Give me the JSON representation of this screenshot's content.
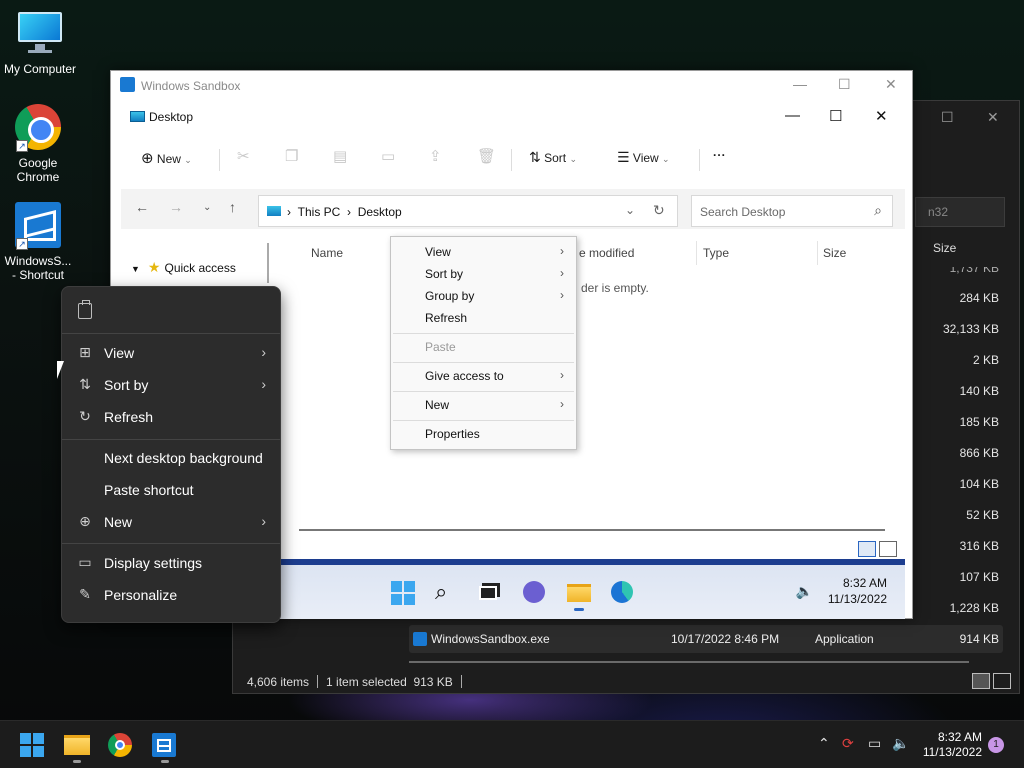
{
  "desktop": {
    "icons": [
      {
        "label": "My Computer",
        "icon": "monitor-icon"
      },
      {
        "label": "Google Chrome",
        "icon": "chrome-icon"
      },
      {
        "label": "WindowsS... - Shortcut",
        "icon": "windows-sandbox-icon"
      }
    ]
  },
  "background_explorer": {
    "search_fragment": "n32",
    "size_header": "Size",
    "partial_top_size": "1,737 KB",
    "sizes": [
      "284 KB",
      "32,133 KB",
      "2 KB",
      "140 KB",
      "185 KB",
      "866 KB",
      "104 KB",
      "52 KB",
      "316 KB",
      "107 KB",
      "1,228 KB"
    ],
    "selected_row": {
      "name": "WindowsSandbox.exe",
      "date": "10/17/2022 8:46 PM",
      "type": "Application",
      "size": "914 KB"
    },
    "status": {
      "items": "4,606 items",
      "selected": "1 item selected",
      "selected_size": "913 KB"
    }
  },
  "sandbox_window": {
    "title": "Windows Sandbox",
    "explorer": {
      "title": "Desktop",
      "toolbar": {
        "new_label": "New",
        "sort_label": "Sort",
        "view_label": "View",
        "more_label": "..."
      },
      "address": {
        "root": "This PC",
        "current": "Desktop"
      },
      "search_placeholder": "Search Desktop",
      "nav": {
        "quick_access": "Quick access"
      },
      "columns": {
        "name": "Name",
        "date_modified_partial": "e modified",
        "type": "Type",
        "size": "Size"
      },
      "empty_partial": "der is empty."
    },
    "context_menu": {
      "items": [
        {
          "label": "View",
          "submenu": true
        },
        {
          "label": "Sort by",
          "submenu": true
        },
        {
          "label": "Group by",
          "submenu": true
        },
        {
          "label": "Refresh",
          "submenu": false
        },
        {
          "label": "Paste",
          "submenu": false,
          "disabled": true
        },
        {
          "label": "Give access to",
          "submenu": true
        },
        {
          "label": "New",
          "submenu": true
        },
        {
          "label": "Properties",
          "submenu": false
        }
      ]
    },
    "taskbar": {
      "time": "8:32 AM",
      "date": "11/13/2022"
    }
  },
  "desktop_context_menu": {
    "items": [
      {
        "label": "View",
        "icon": "grid-icon",
        "submenu": true
      },
      {
        "label": "Sort by",
        "icon": "sort-icon",
        "submenu": true
      },
      {
        "label": "Refresh",
        "icon": "refresh-icon",
        "submenu": false
      },
      {
        "label": "Next desktop background",
        "icon": "",
        "submenu": false
      },
      {
        "label": "Paste shortcut",
        "icon": "",
        "submenu": false
      },
      {
        "label": "New",
        "icon": "plus-circle-icon",
        "submenu": true
      },
      {
        "label": "Display settings",
        "icon": "display-icon",
        "submenu": false
      },
      {
        "label": "Personalize",
        "icon": "pen-icon",
        "submenu": false
      }
    ]
  },
  "taskbar": {
    "apps": [
      "start-icon",
      "file-explorer-icon",
      "chrome-icon",
      "windows-sandbox-icon"
    ],
    "time": "8:32 AM",
    "date": "11/13/2022",
    "notification_count": "1"
  }
}
